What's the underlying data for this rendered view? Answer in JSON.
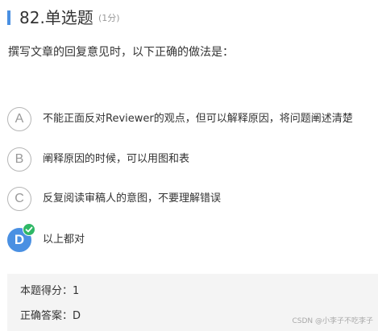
{
  "question": {
    "title": "82.单选题",
    "score_label": "(1分)",
    "stem": "撰写文章的回复意见时，以下正确的做法是："
  },
  "options": [
    {
      "letter": "A",
      "text": "不能正面反对Reviewer的观点，但可以解释原因，将问题阐述清楚",
      "selected": false
    },
    {
      "letter": "B",
      "text": "阐释原因的时候，可以用图和表",
      "selected": false
    },
    {
      "letter": "C",
      "text": "反复阅读审稿人的意图，不要理解错误",
      "selected": false
    },
    {
      "letter": "D",
      "text": "以上都对",
      "selected": true
    }
  ],
  "result": {
    "score_label": "本题得分：",
    "score_value": "1",
    "answer_label": "正确答案：",
    "answer_value": "D"
  },
  "watermark": "CSDN @小李子不吃李子",
  "colors": {
    "accent": "#4a90e2",
    "check_green": "#2fb866",
    "result_bg": "#f4f4f4"
  },
  "icons": {
    "selected_badge": "check-icon"
  }
}
